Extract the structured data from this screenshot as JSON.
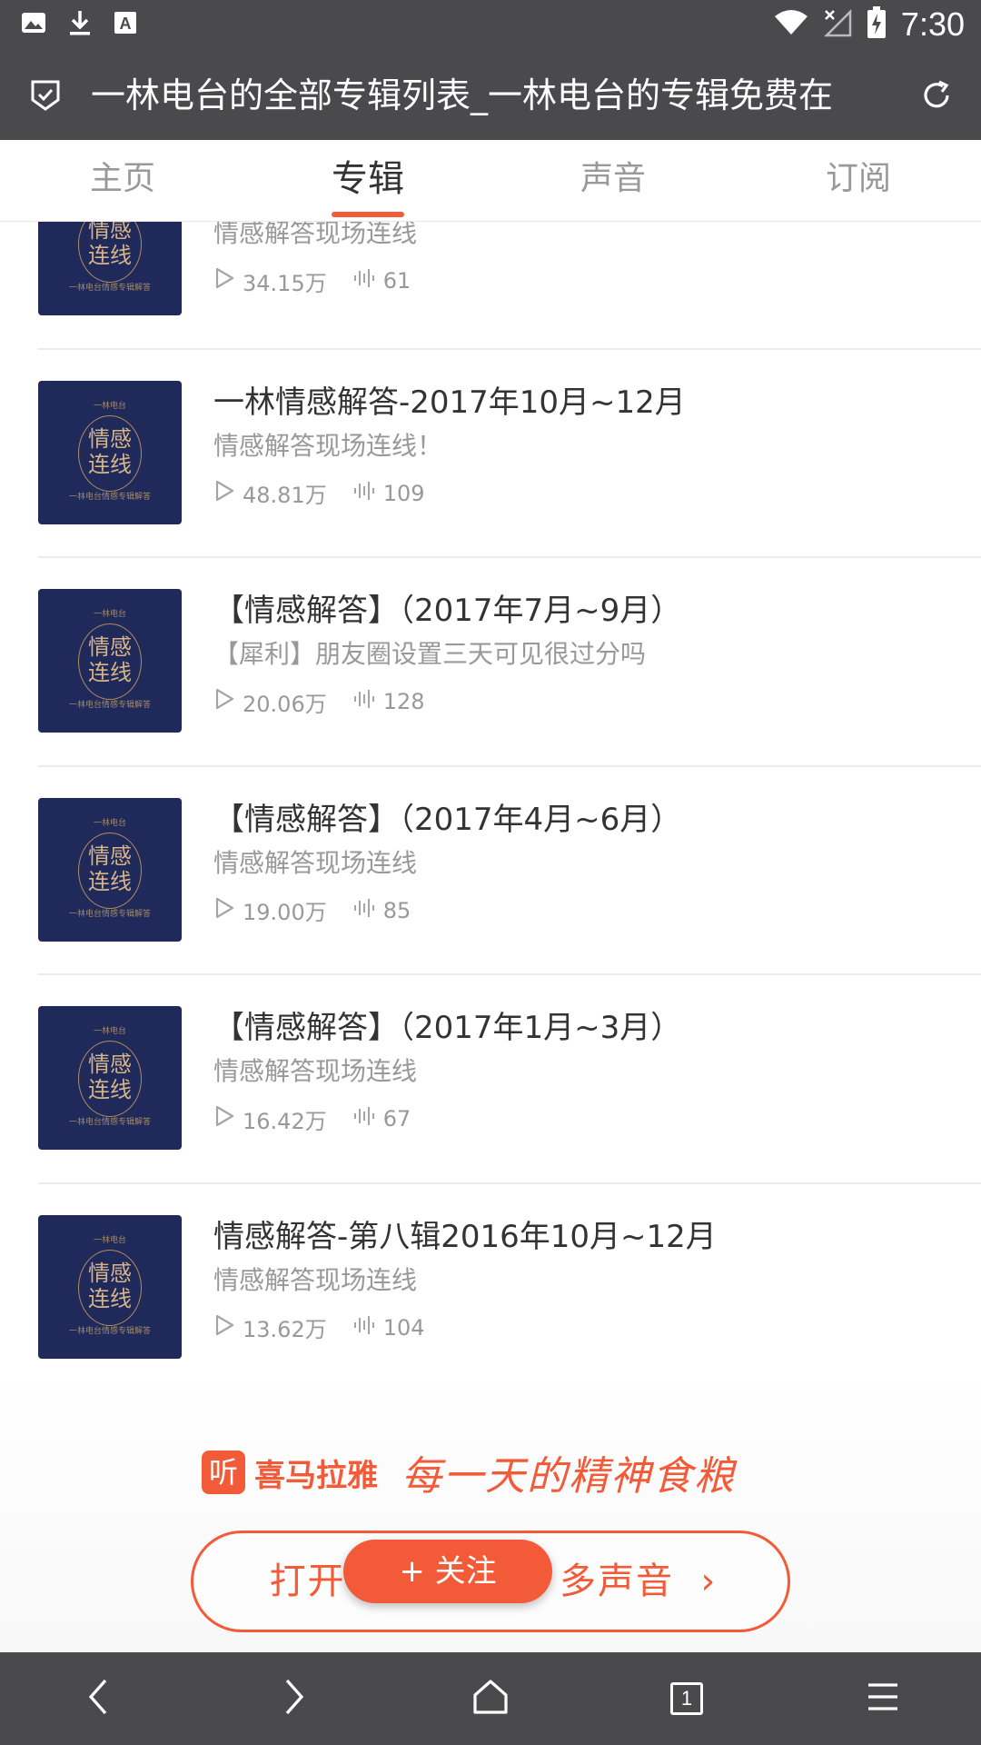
{
  "status_bar": {
    "time": "7:30",
    "icons": [
      "image-icon",
      "download-icon",
      "a-icon",
      "wifi-icon",
      "signal-off-icon",
      "battery-charging-icon"
    ]
  },
  "browser": {
    "title": "一林电台的全部专辑列表_一林电台的专辑免费在",
    "icons": [
      "shield-check-icon",
      "refresh-icon"
    ]
  },
  "tabs": [
    {
      "label": "主页",
      "active": false
    },
    {
      "label": "专辑",
      "active": true
    },
    {
      "label": "声音",
      "active": false
    },
    {
      "label": "订阅",
      "active": false
    }
  ],
  "cover": {
    "small_top": "一林电台",
    "main_line1": "情感",
    "main_line2": "连线",
    "small_bottom": "一林电台情感专辑解答"
  },
  "albums": [
    {
      "title": "",
      "subtitle": "情感解答现场连线",
      "plays": "34.15万",
      "tracks": "61"
    },
    {
      "title": "一林情感解答-2017年10月~12月",
      "subtitle": "情感解答现场连线！",
      "plays": "48.81万",
      "tracks": "109"
    },
    {
      "title": "【情感解答】（2017年7月~9月）",
      "subtitle": "【犀利】朋友圈设置三天可见很过分吗",
      "plays": "20.06万",
      "tracks": "128"
    },
    {
      "title": "【情感解答】（2017年4月~6月）",
      "subtitle": "情感解答现场连线",
      "plays": "19.00万",
      "tracks": "85"
    },
    {
      "title": "【情感解答】（2017年1月~3月）",
      "subtitle": "情感解答现场连线",
      "plays": "16.42万",
      "tracks": "67"
    },
    {
      "title": "情感解答-第八辑2016年10月~12月",
      "subtitle": "情感解答现场连线",
      "plays": "13.62万",
      "tracks": "104"
    }
  ],
  "banner": {
    "logo_glyph": "听",
    "brand": "喜马拉雅",
    "slogan": "每一天的精神食粮",
    "open_label": "打开                多声音  ›",
    "follow_label": "+ 关注"
  },
  "bottom_nav": {
    "tab_count": "1",
    "icons": [
      "back-icon",
      "forward-icon",
      "home-icon",
      "tabs-icon",
      "menu-icon"
    ]
  },
  "colors": {
    "accent": "#f35a37",
    "bar": "#4a4a4c",
    "cover_bg": "#1f2a5a"
  }
}
